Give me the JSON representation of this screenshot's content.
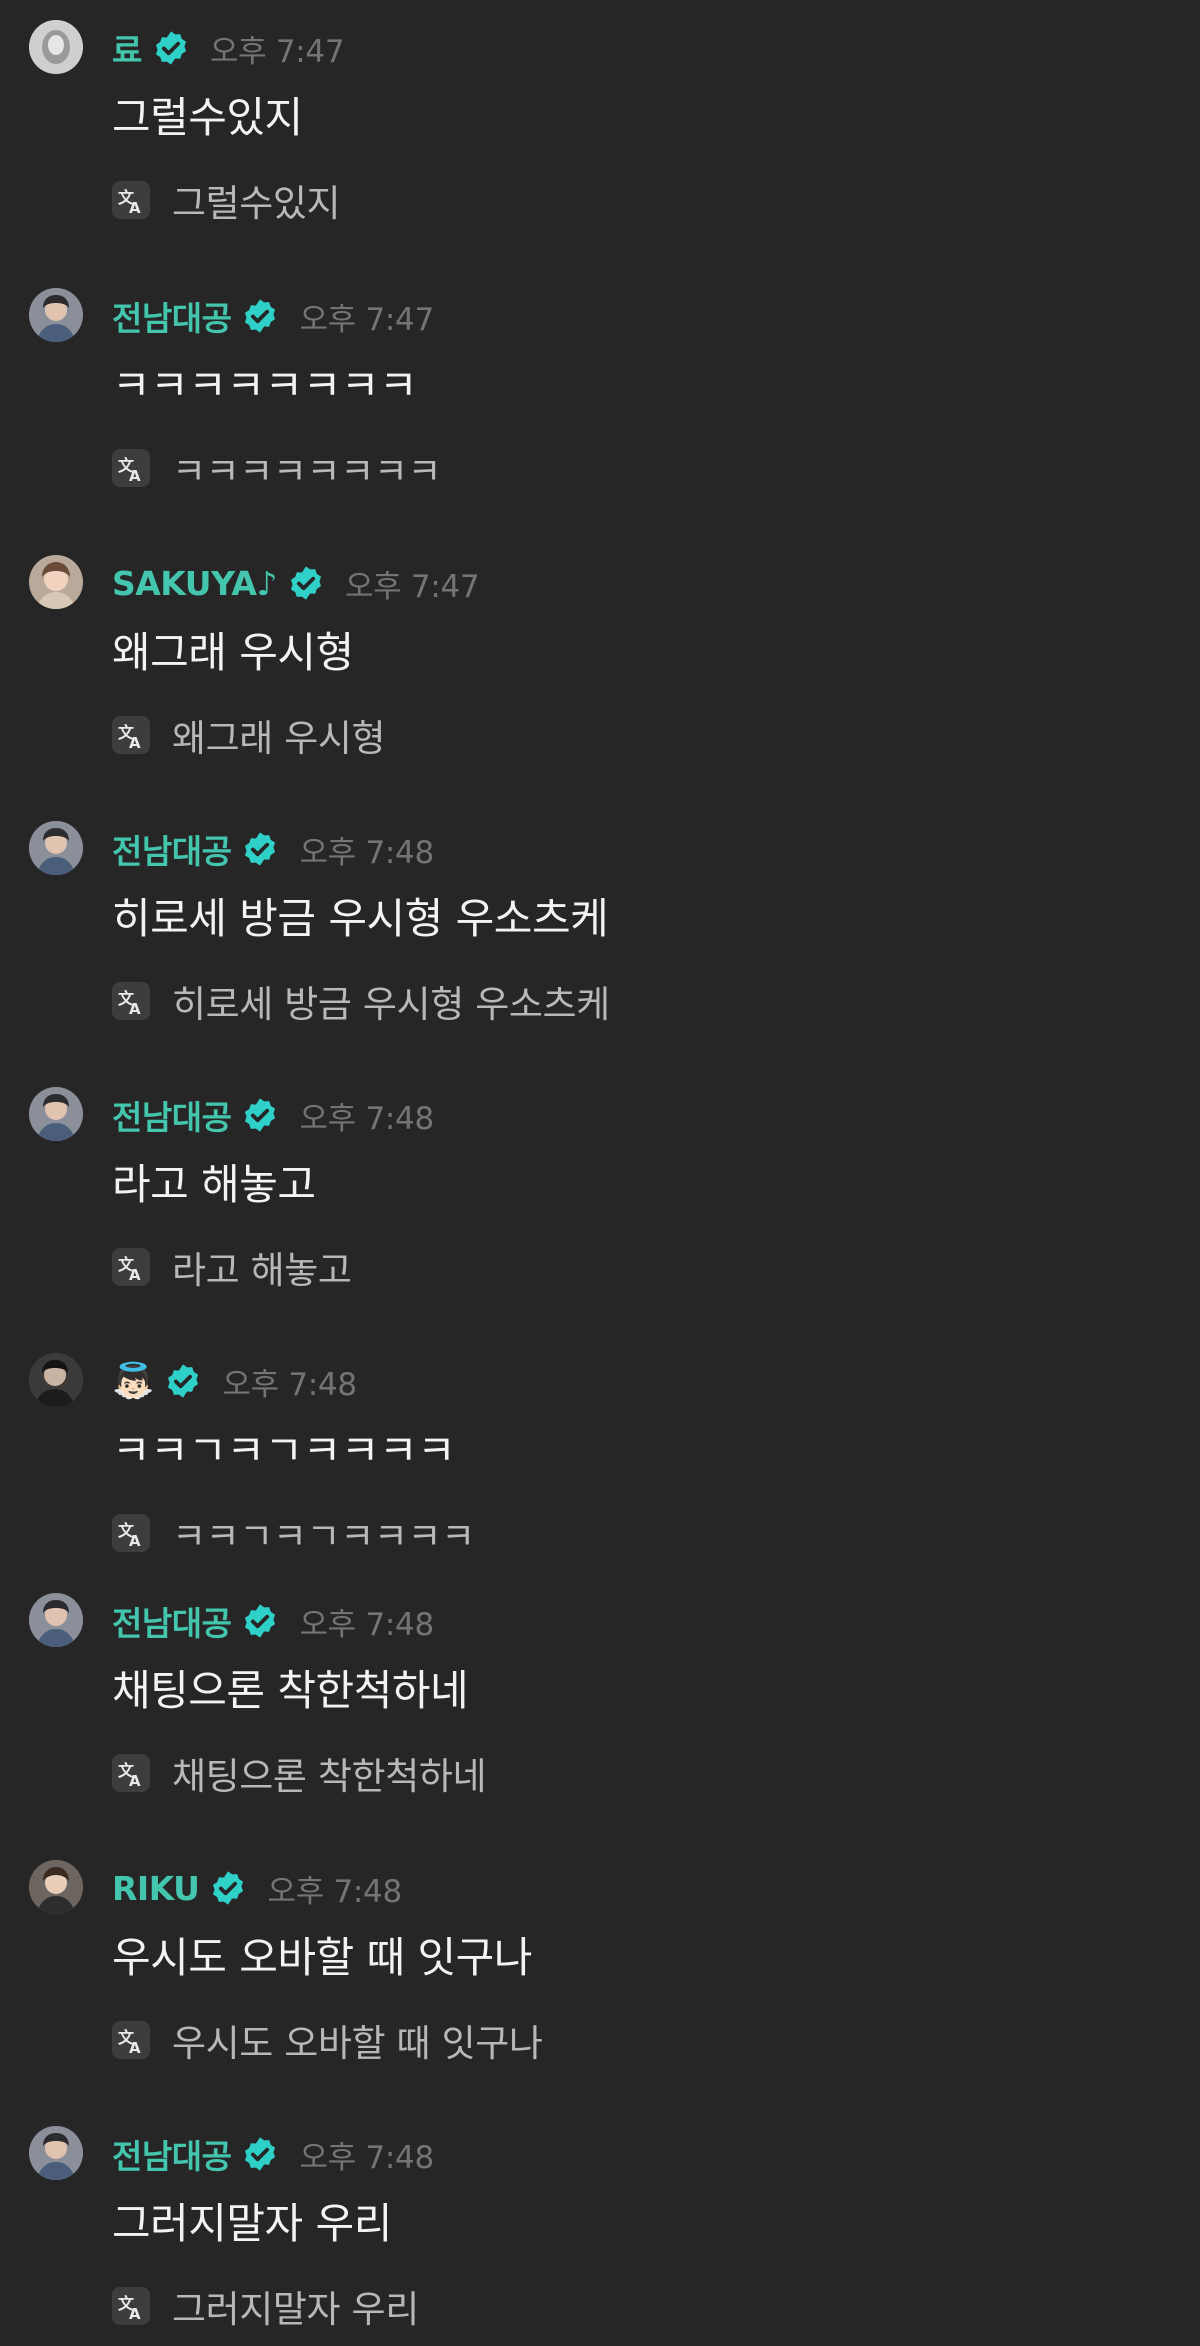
{
  "messages": [
    {
      "user": "료",
      "verified": true,
      "time": "오후 7:47",
      "text": "그럴수있지",
      "translation": "그럴수있지",
      "avatar_icon": "avatar-light"
    },
    {
      "user": "전남대공",
      "verified": true,
      "time": "오후 7:47",
      "text": "ㅋㅋㅋㅋㅋㅋㅋㅋ",
      "translation": "ㅋㅋㅋㅋㅋㅋㅋㅋ",
      "avatar_icon": "avatar-person"
    },
    {
      "user": "SAKUYA♪",
      "verified": true,
      "time": "오후 7:47",
      "text": "왜그래 우시형",
      "translation": "왜그래 우시형",
      "avatar_icon": "avatar-person"
    },
    {
      "user": "전남대공",
      "verified": true,
      "time": "오후 7:48",
      "text": "히로세 방금 우시형 우소츠케",
      "translation": "히로세 방금 우시형 우소츠케",
      "avatar_icon": "avatar-person"
    },
    {
      "user": "전남대공",
      "verified": true,
      "time": "오후 7:48",
      "text": "라고 해놓고",
      "translation": "라고 해놓고",
      "avatar_icon": "avatar-person"
    },
    {
      "user": "👼🏻",
      "verified": true,
      "time": "오후 7:48",
      "text": "ㅋㅋㄱㅋㄱㅋㅋㅋㅋ",
      "translation": "ㅋㅋㄱㅋㄱㅋㅋㅋㅋ",
      "avatar_icon": "avatar-dark"
    },
    {
      "user": "전남대공",
      "verified": true,
      "time": "오후 7:48",
      "text": "채팅으론 착한척하네",
      "translation": "채팅으론 착한척하네",
      "avatar_icon": "avatar-person"
    },
    {
      "user": "RIKU",
      "verified": true,
      "time": "오후 7:48",
      "text": "우시도 오바할 때 잇구나",
      "translation": "우시도 오바할 때 잇구나",
      "avatar_icon": "avatar-person"
    },
    {
      "user": "전남대공",
      "verified": true,
      "time": "오후 7:48",
      "text": "그러지말자 우리",
      "translation": "그러지말자 우리",
      "avatar_icon": "avatar-person"
    }
  ],
  "icons": {
    "verified": "verified-badge-icon",
    "translate": "translate-icon"
  },
  "colors": {
    "background": "#262626",
    "username": "#43c6ad",
    "verified_badge": "#2fd0c8",
    "timestamp": "#747474",
    "message_text": "#f3f3f3",
    "translation_text": "#b8b8b8"
  }
}
